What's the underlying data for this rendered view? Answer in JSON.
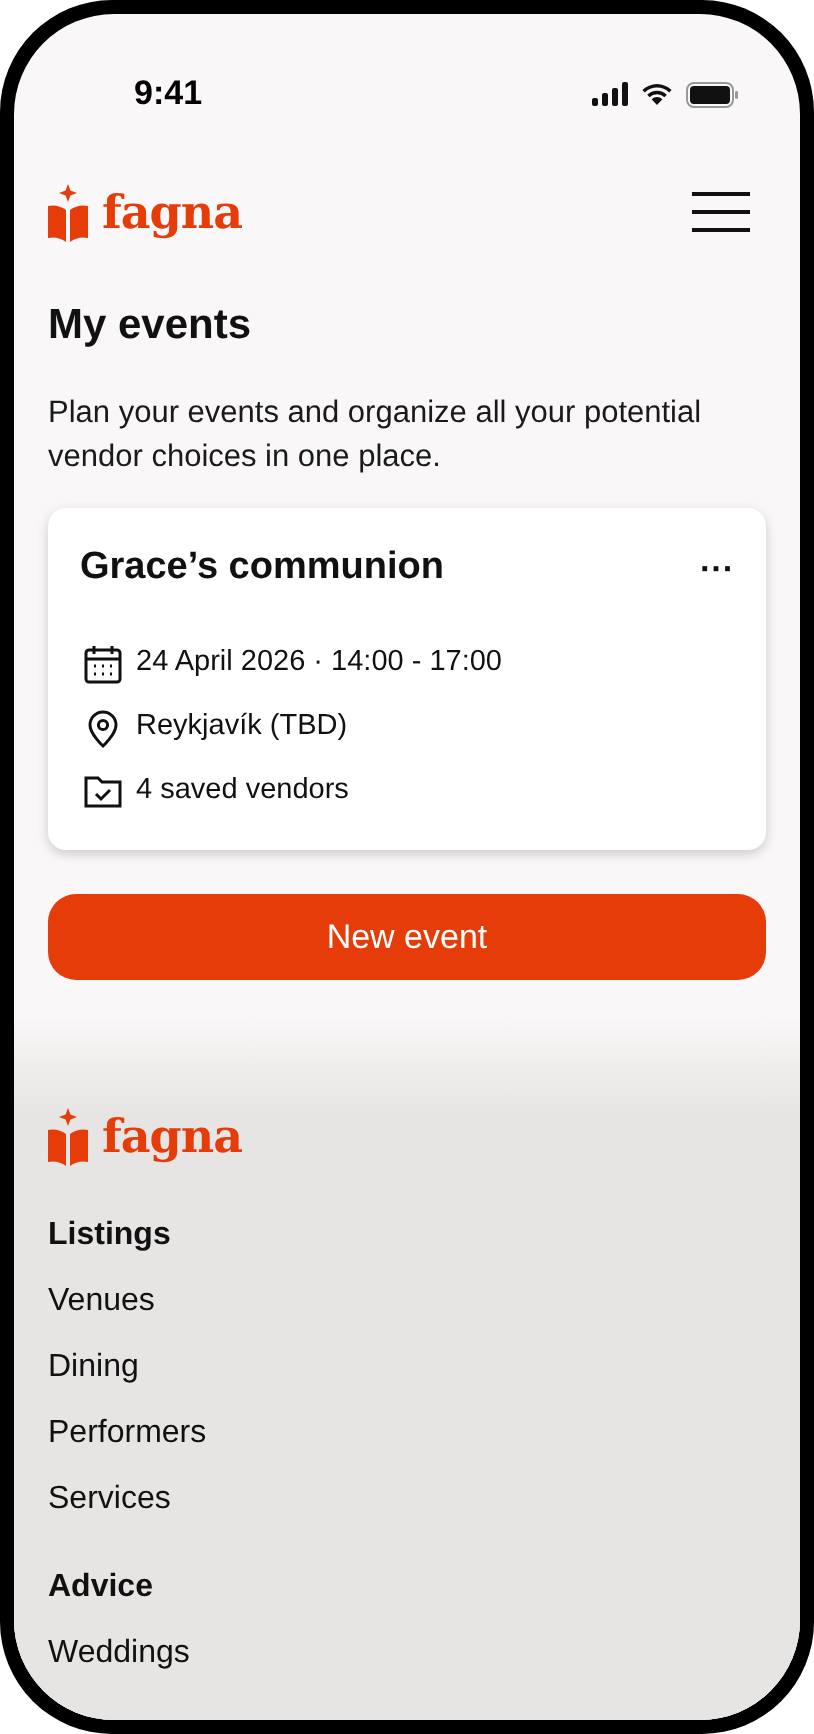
{
  "status_bar": {
    "time": "9:41"
  },
  "header": {
    "logo": "fagna"
  },
  "page": {
    "title": "My events",
    "intro": "Plan your events and organize all your potential vendor choices in one place."
  },
  "events": [
    {
      "title": "Grace’s communion",
      "more": "···",
      "details": [
        {
          "kind": "date",
          "text": "24 April 2026 · 14:00 - 17:00"
        },
        {
          "kind": "location",
          "text": "Reykjavík (TBD)"
        },
        {
          "kind": "vendors",
          "text": "4 saved vendors"
        }
      ]
    }
  ],
  "new_event_button": "New event",
  "footer": {
    "logo": "fagna",
    "sections": [
      {
        "heading": "Listings",
        "links": [
          "Venues",
          "Dining",
          "Performers",
          "Services"
        ]
      },
      {
        "heading": "Advice",
        "links": [
          "Weddings"
        ]
      }
    ]
  }
}
